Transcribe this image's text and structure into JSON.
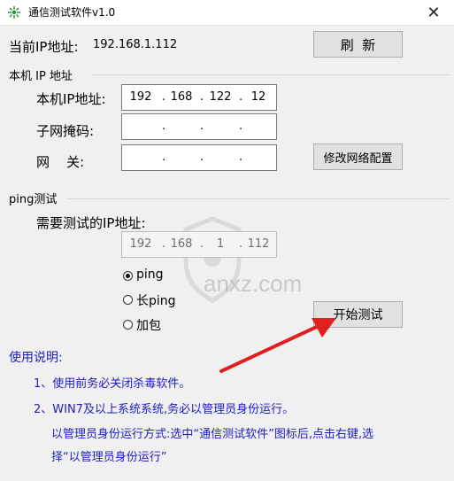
{
  "window": {
    "title": "通信测试软件v1.0",
    "close_glyph": "✕"
  },
  "current_ip": {
    "label": "当前IP地址:",
    "value": "192.168.1.112",
    "refresh_label": "刷  新"
  },
  "local_group": {
    "title": "本机 IP 地址",
    "ip_label": "本机IP地址:",
    "ip": [
      "192",
      "168",
      "122",
      "12"
    ],
    "mask_label": "子网掩码:",
    "mask": [
      "",
      "",
      "",
      ""
    ],
    "gateway_label": "网    关:",
    "gateway": [
      "",
      "",
      "",
      ""
    ],
    "modify_label": "修改网络配置"
  },
  "ping_group": {
    "title": "ping测试",
    "target_label": "需要测试的IP地址:",
    "target_ip": [
      "192",
      "168",
      "1",
      "112"
    ],
    "options": [
      {
        "label": "ping",
        "checked": true
      },
      {
        "label": "长ping",
        "checked": false
      },
      {
        "label": "加包",
        "checked": false
      }
    ],
    "start_label": "开始测试"
  },
  "usage": {
    "title": "使用说明:",
    "line1": "1、使用前务必关闭杀毒软件。",
    "line2": "2、WIN7及以上系统系统,务必以管理员身份运行。",
    "line3": "以管理员身份运行方式:选中“通信测试软件”图标后,点击右键,选",
    "line4": "择“以管理员身份运行”"
  },
  "watermark": {
    "text": "anxz.com"
  },
  "colors": {
    "usage_text": "#1e1ebe",
    "arrow": "#e02020"
  },
  "icons": {
    "app": "network-icon",
    "close": "close-icon"
  }
}
